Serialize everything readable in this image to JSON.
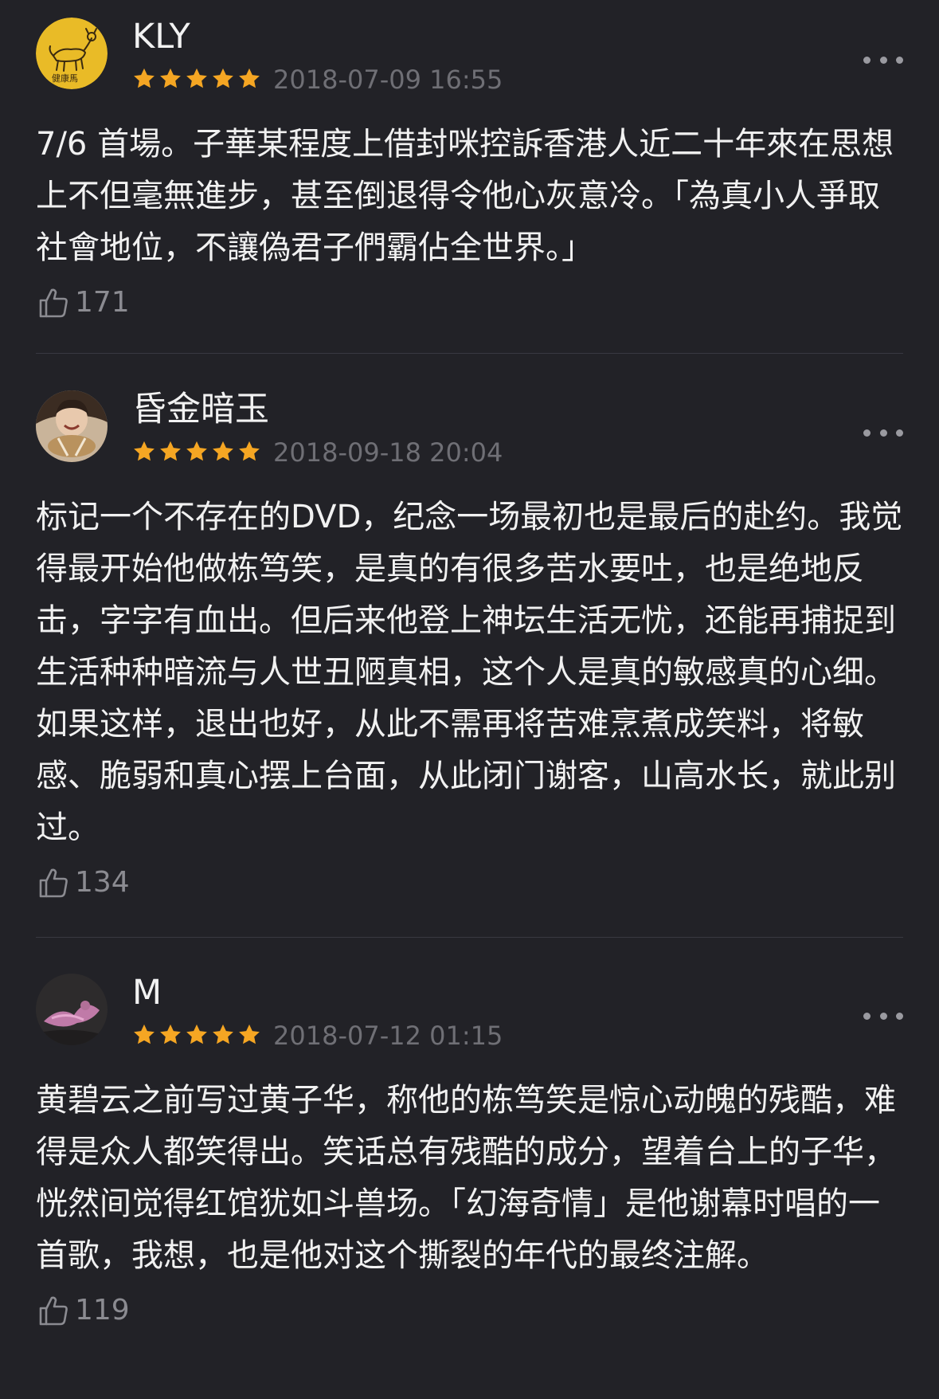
{
  "colors": {
    "background": "#222227",
    "star": "#f5a623",
    "text": "#f1f1f1",
    "muted": "#6f6f75",
    "divider": "#393941"
  },
  "icons": {
    "more": "ellipsis-icon",
    "like": "thumbs-up-icon",
    "star": "star-icon"
  },
  "reviews": [
    {
      "username": "KLY",
      "rating": 5,
      "timestamp": "2018-07-09 16:55",
      "text": "7/6 首場。子華某程度上借封咪控訴香港人近二十年來在思想上不但毫無進步，甚至倒退得令他心灰意冷。「為真小人爭取社會地位，不讓偽君子們霸佔全世界。」",
      "likes": "171"
    },
    {
      "username": "昏金暗玉",
      "rating": 5,
      "timestamp": "2018-09-18 20:04",
      "text": "标记一个不存在的DVD，纪念一场最初也是最后的赴约。我觉得最开始他做栋笃笑，是真的有很多苦水要吐，也是绝地反击，字字有血出。但后来他登上神坛生活无忧，还能再捕捉到生活种种暗流与人世丑陋真相，这个人是真的敏感真的心细。如果这样，退出也好，从此不需再将苦难烹煮成笑料，将敏感、脆弱和真心摆上台面，从此闭门谢客，山高水长，就此别过。",
      "likes": "134"
    },
    {
      "username": "M",
      "rating": 5,
      "timestamp": "2018-07-12 01:15",
      "text": "黄碧云之前写过黄子华，称他的栋笃笑是惊心动魄的残酷，难得是众人都笑得出。笑话总有残酷的成分，望着台上的子华，恍然间觉得红馆犹如斗兽场。「幻海奇情」是他谢幕时唱的一首歌，我想，也是他对这个撕裂的年代的最终注解。",
      "likes": "119"
    }
  ]
}
